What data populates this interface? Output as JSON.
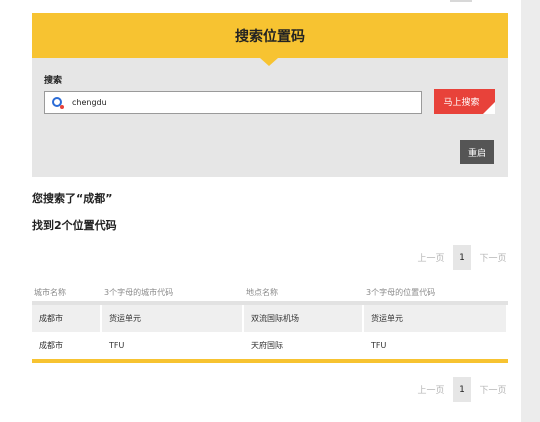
{
  "panel": {
    "title": "搜索位置码",
    "search_label": "搜索",
    "search_value": "chengdu",
    "search_button": "马上搜索",
    "reset_button": "重启"
  },
  "results": {
    "searched_text": "您搜索了“成都”",
    "count_text": "找到2个位置代码"
  },
  "pager": {
    "prev": "上一页",
    "current": "1",
    "next": "下一页"
  },
  "table": {
    "headers": [
      "城市名称",
      "3个字母的城市代码",
      "地点名称",
      "3个字母的位置代码"
    ],
    "rows": [
      [
        "成都市",
        "货运单元",
        "双流国际机场",
        "货运单元"
      ],
      [
        "成都市",
        "TFU",
        "天府国际",
        "TFU"
      ]
    ]
  },
  "colors": {
    "accent_yellow": "#f7c331",
    "search_red": "#e8423a",
    "reset_gray": "#555555"
  },
  "icons": {
    "search": "search-icon"
  }
}
